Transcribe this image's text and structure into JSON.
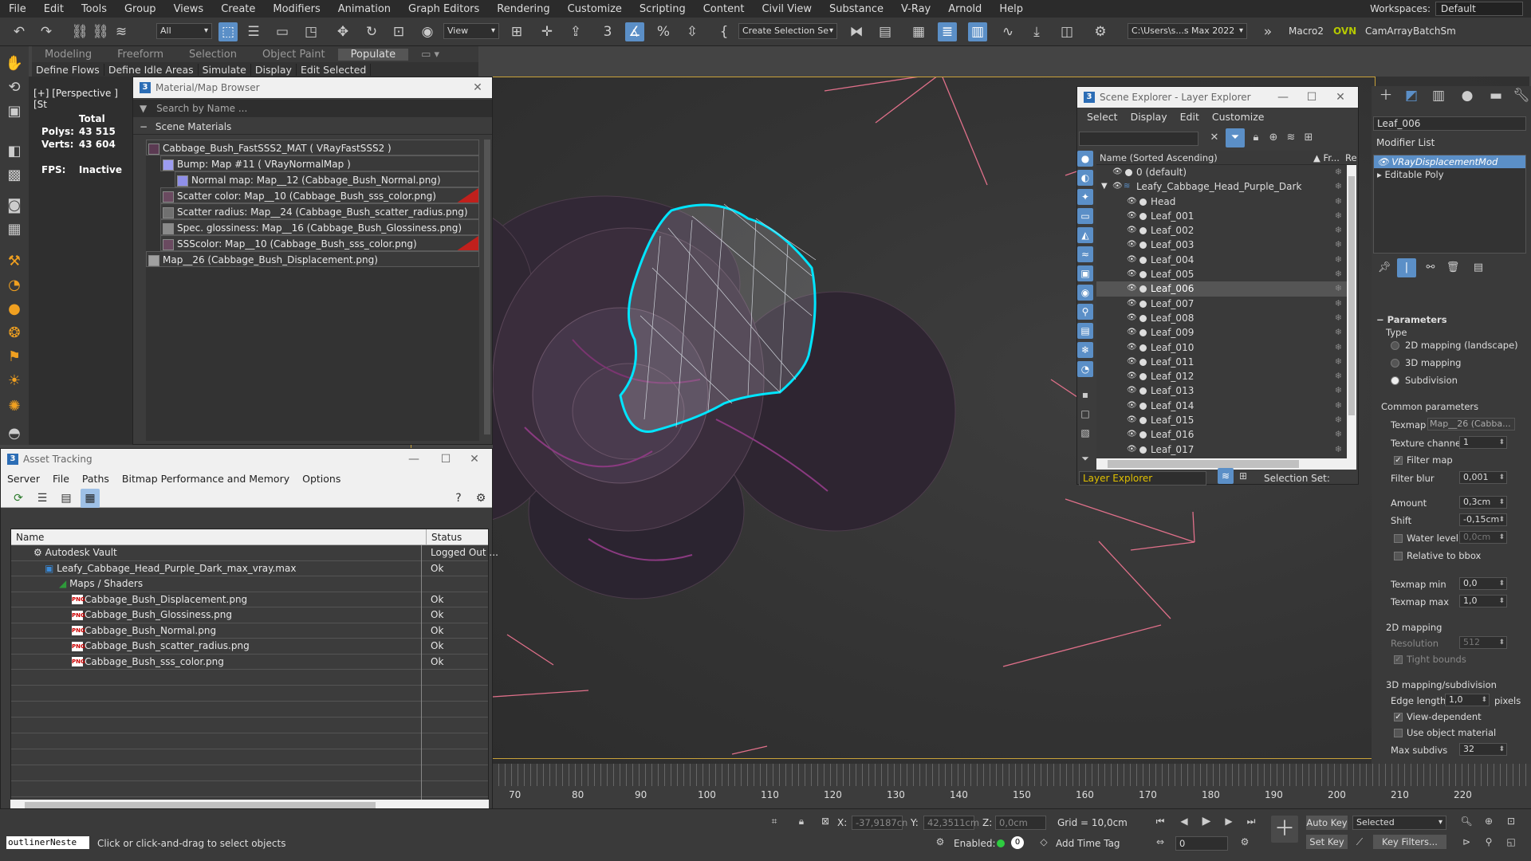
{
  "menu": [
    "File",
    "Edit",
    "Tools",
    "Group",
    "Views",
    "Create",
    "Modifiers",
    "Animation",
    "Graph Editors",
    "Rendering",
    "Customize",
    "Scripting",
    "Content",
    "Civil View",
    "Substance",
    "V-Ray",
    "Arnold",
    "Help"
  ],
  "workspaces": {
    "label": "Workspaces:",
    "value": "Default"
  },
  "toolbar": {
    "filter": "All",
    "refcoord": "View",
    "selset": "Create Selection Se",
    "path": "C:\\Users\\s...s Max 2022",
    "macro2": "Macro2",
    "ovn": "OVN",
    "camarray": "CamArray",
    "batchsm": "BatchSm"
  },
  "ribbon": {
    "tabs": [
      "Modeling",
      "Freeform",
      "Selection",
      "Object Paint",
      "Populate"
    ],
    "active": "Populate",
    "sub": [
      "Define Flows",
      "Define Idle Areas",
      "Simulate",
      "Display",
      "Edit Selected"
    ]
  },
  "viewport": {
    "label": "[+] [Perspective ] [St",
    "stats": {
      "total": "Total",
      "polys_label": "Polys:",
      "polys": "43 515",
      "verts_label": "Verts:",
      "verts": "43 604",
      "fps_label": "FPS:",
      "fps": "Inactive"
    }
  },
  "material_browser": {
    "title": "Material/Map Browser",
    "search": "Search by Name ...",
    "section": "Scene Materials",
    "rows": [
      {
        "text": "Cabbage_Bush_FastSSS2_MAT  ( VRayFastSSS2 )",
        "indent": 0,
        "swatch": "#5b3a52",
        "red": false
      },
      {
        "text": "Bump: Map #11  ( VRayNormalMap )",
        "indent": 1,
        "swatch": "#9c9cf0",
        "red": false
      },
      {
        "text": "Normal map: Map__12 (Cabbage_Bush_Normal.png)",
        "indent": 2,
        "swatch": "#8f8fe8",
        "red": false
      },
      {
        "text": "Scatter color: Map__10 (Cabbage_Bush_sss_color.png)",
        "indent": 1,
        "swatch": "#6a4a60",
        "red": true
      },
      {
        "text": "Scatter radius: Map__24 (Cabbage_Bush_scatter_radius.png)",
        "indent": 1,
        "swatch": "#707070",
        "red": false
      },
      {
        "text": "Spec. glossiness: Map__16 (Cabbage_Bush_Glossiness.png)",
        "indent": 1,
        "swatch": "#8a8a8a",
        "red": false
      },
      {
        "text": "SSScolor: Map__10 (Cabbage_Bush_sss_color.png)",
        "indent": 1,
        "swatch": "#6a4a60",
        "red": true
      },
      {
        "text": "Map__26 (Cabbage_Bush_Displacement.png)",
        "indent": 0,
        "swatch": "#a0a0a0",
        "red": false
      }
    ]
  },
  "asset_tracking": {
    "title": "Asset Tracking",
    "menu": [
      "Server",
      "File",
      "Paths",
      "Bitmap Performance and Memory",
      "Options"
    ],
    "col_name": "Name",
    "col_status": "Status",
    "rows": [
      {
        "name": "Autodesk Vault",
        "status": "Logged Out ..."
      },
      {
        "name": "Leafy_Cabbage_Head_Purple_Dark_max_vray.max",
        "status": "Ok"
      },
      {
        "name": "Maps / Shaders",
        "status": ""
      },
      {
        "name": "Cabbage_Bush_Displacement.png",
        "status": "Ok"
      },
      {
        "name": "Cabbage_Bush_Glossiness.png",
        "status": "Ok"
      },
      {
        "name": "Cabbage_Bush_Normal.png",
        "status": "Ok"
      },
      {
        "name": "Cabbage_Bush_scatter_radius.png",
        "status": "Ok"
      },
      {
        "name": "Cabbage_Bush_sss_color.png",
        "status": "Ok"
      }
    ]
  },
  "scene_explorer": {
    "title": "Scene Explorer - Layer Explorer",
    "menu": [
      "Select",
      "Display",
      "Edit",
      "Customize"
    ],
    "col_name": "Name (Sorted Ascending)",
    "col_fr": "▲ Fr...",
    "col_re": "Re",
    "layer_default": "0 (default)",
    "layer_main": "Leafy_Cabbage_Head_Purple_Dark",
    "items": [
      "Head",
      "Leaf_001",
      "Leaf_002",
      "Leaf_003",
      "Leaf_004",
      "Leaf_005",
      "Leaf_006",
      "Leaf_007",
      "Leaf_008",
      "Leaf_009",
      "Leaf_010",
      "Leaf_011",
      "Leaf_012",
      "Leaf_013",
      "Leaf_014",
      "Leaf_015",
      "Leaf_016",
      "Leaf_017",
      "Leafy_Cabbage_Head_Purple_Dark"
    ],
    "selected": "Leaf_006",
    "footer_left": "Layer Explorer",
    "footer_right": "Selection Set:"
  },
  "modify_panel": {
    "object_name": "Leaf_006",
    "modifier_list": "Modifier List",
    "stack": [
      "VRayDisplacementMod",
      "Editable Poly"
    ],
    "parameters": "Parameters",
    "type_label": "Type",
    "types": [
      "2D mapping (landscape)",
      "3D mapping",
      "Subdivision"
    ],
    "type_selected": 2,
    "common": "Common parameters",
    "texmap_label": "Texmap",
    "texmap": "Map__26 (Cabba...",
    "texchan_label": "Texture channel",
    "texchan": "1",
    "filter_map": "Filter map",
    "filter_blur_label": "Filter blur",
    "filter_blur": "0,001",
    "amount_label": "Amount",
    "amount": "0,3cm",
    "shift_label": "Shift",
    "shift": "-0,15cm",
    "water_label": "Water level",
    "water": "0,0cm",
    "relbbox": "Relative to bbox",
    "texmin_label": "Texmap min",
    "texmin": "0,0",
    "texmax_label": "Texmap max",
    "texmax": "1,0",
    "map2d": "2D mapping",
    "resolution_label": "Resolution",
    "resolution": "512",
    "tight": "Tight bounds",
    "map3d": "3D mapping/subdivision",
    "edge_label": "Edge length",
    "edge": "1,0",
    "pixels": "pixels",
    "viewdep": "View-dependent",
    "useobj": "Use object material",
    "maxsub_label": "Max subdivs",
    "maxsub": "32"
  },
  "timeline": {
    "ticks": [
      "70",
      "80",
      "90",
      "100",
      "110",
      "120",
      "130",
      "140",
      "150",
      "160",
      "170",
      "180",
      "190",
      "200",
      "210",
      "220"
    ]
  },
  "status": {
    "script_label": "outlinerNeste",
    "prompt": "Click or click-and-drag to select objects",
    "x_label": "X:",
    "x": "-37,9187cn",
    "y_label": "Y:",
    "y": "42,3511cm",
    "z_label": "Z:",
    "z": "0,0cm",
    "grid": "Grid = 10,0cm",
    "enabled": "Enabled:",
    "addtag": "Add Time Tag",
    "frame": "0",
    "autokey": "Auto Key",
    "setkey": "Set Key",
    "selected": "Selected",
    "keyfilters": "Key Filters..."
  },
  "colors": {
    "accent": "#5b8fc7",
    "highlight": "#00e5ff",
    "bbox": "#e0708a",
    "frame": "#c9a23a"
  }
}
